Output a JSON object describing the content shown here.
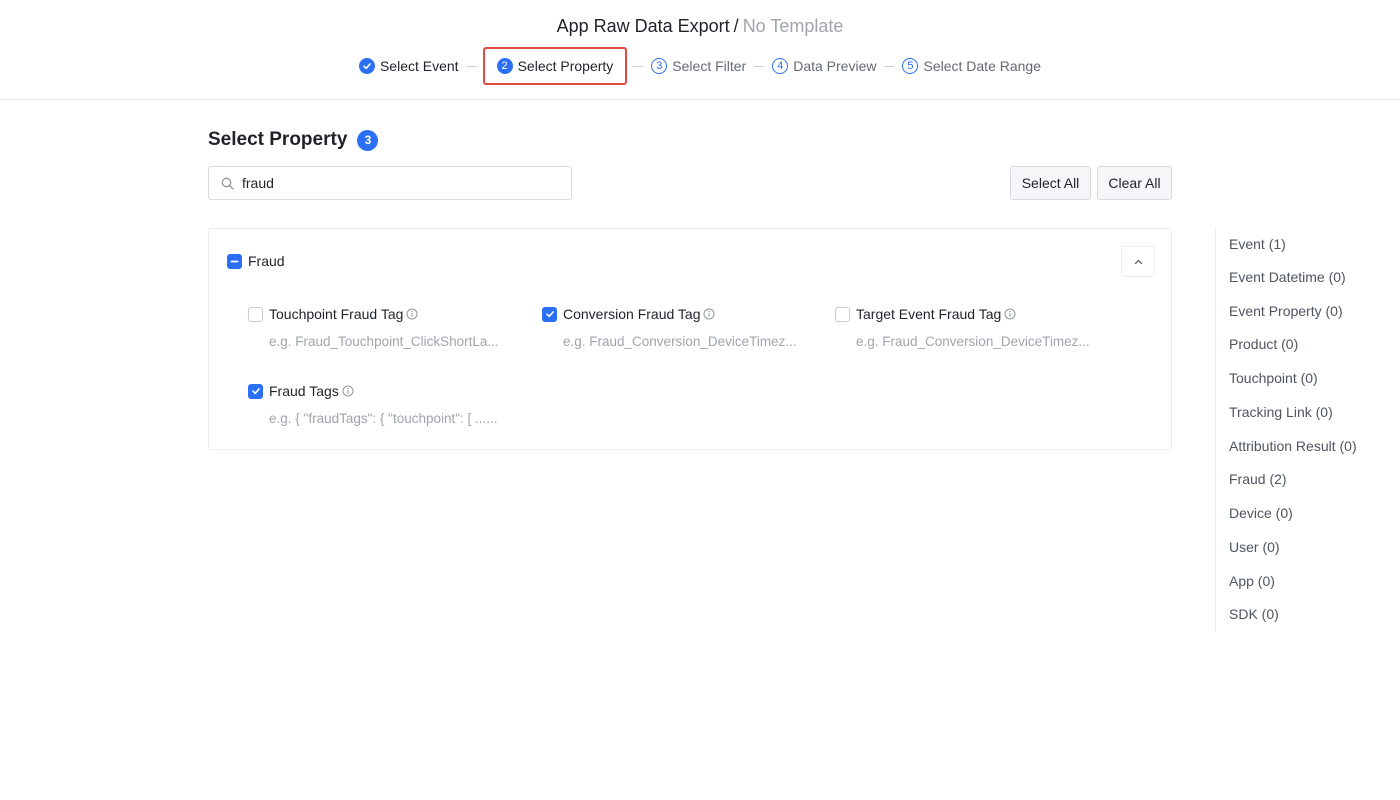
{
  "header": {
    "title": "App Raw Data Export",
    "separator": "/",
    "subtitle": "No Template"
  },
  "steps": [
    {
      "num": "✓",
      "label": "Select Event",
      "state": "done"
    },
    {
      "num": "2",
      "label": "Select Property",
      "state": "active"
    },
    {
      "num": "3",
      "label": "Select Filter",
      "state": "todo"
    },
    {
      "num": "4",
      "label": "Data Preview",
      "state": "todo"
    },
    {
      "num": "5",
      "label": "Select Date Range",
      "state": "todo"
    }
  ],
  "main": {
    "title": "Select Property",
    "selected_count": "3",
    "search": {
      "value": "fraud",
      "placeholder": ""
    },
    "select_all_label": "Select All",
    "clear_all_label": "Clear All"
  },
  "group": {
    "label": "Fraud",
    "properties": [
      {
        "label": "Touchpoint Fraud Tag",
        "example": "e.g. Fraud_Touchpoint_ClickShortLa...",
        "checked": false
      },
      {
        "label": "Conversion Fraud Tag",
        "example": "e.g. Fraud_Conversion_DeviceTimez...",
        "checked": true
      },
      {
        "label": "Target Event Fraud Tag",
        "example": "e.g. Fraud_Conversion_DeviceTimez...",
        "checked": false
      },
      {
        "label": "Fraud Tags",
        "example": "e.g. { \"fraudTags\": { \"touchpoint\": [ ......",
        "checked": true
      }
    ]
  },
  "side_nav": [
    "Event (1)",
    "Event Datetime (0)",
    "Event Property (0)",
    "Product (0)",
    "Touchpoint (0)",
    "Tracking Link (0)",
    "Attribution Result (0)",
    "Fraud (2)",
    "Device (0)",
    "User (0)",
    "App (0)",
    "SDK (0)"
  ],
  "colors": {
    "accent": "#2b6ff5",
    "active_step_border": "#e04a45",
    "muted_text": "#a0a5ad"
  }
}
